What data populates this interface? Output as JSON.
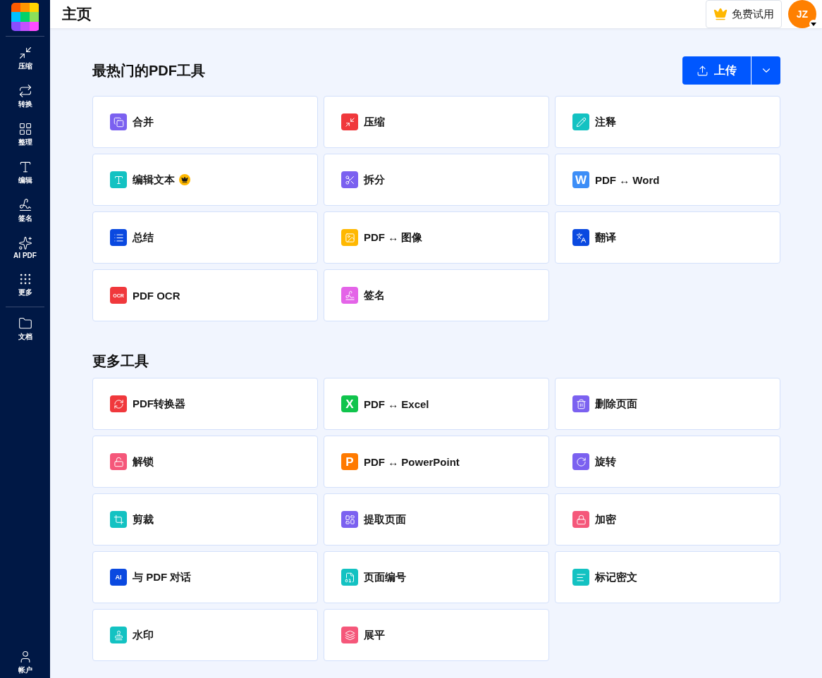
{
  "header": {
    "title": "主页",
    "trial_button": "免费试用",
    "avatar": "JZ"
  },
  "sidebar": {
    "items": [
      {
        "label": "压缩"
      },
      {
        "label": "转换"
      },
      {
        "label": "整理"
      },
      {
        "label": "编辑"
      },
      {
        "label": "签名"
      },
      {
        "label": "AI PDF"
      },
      {
        "label": "更多"
      }
    ],
    "documents": {
      "label": "文档"
    },
    "account": {
      "label": "帐户"
    }
  },
  "popular": {
    "title": "最热门的PDF工具",
    "upload_button": "上传",
    "tools": [
      {
        "label": "合并",
        "color": "#7b61f0"
      },
      {
        "label": "压缩",
        "color": "#f0383c"
      },
      {
        "label": "注释",
        "color": "#13c2c2"
      },
      {
        "label": "编辑文本",
        "color": "#13c2c2",
        "premium": true
      },
      {
        "label": "拆分",
        "color": "#7b61f0"
      },
      {
        "label": "PDF ↔ Word",
        "color": "#3d8ef7",
        "icon_text": "W"
      },
      {
        "label": "总结",
        "color": "#0a49e0"
      },
      {
        "label": "PDF ↔ 图像",
        "color": "#ffb800"
      },
      {
        "label": "翻译",
        "color": "#0a49e0"
      },
      {
        "label": "PDF OCR",
        "color": "#f0383c",
        "icon_text": "OCR"
      },
      {
        "label": "签名",
        "color": "#e464e8"
      }
    ]
  },
  "more": {
    "title": "更多工具",
    "tools": [
      {
        "label": "PDF转换器",
        "color": "#f0383c"
      },
      {
        "label": "PDF ↔ Excel",
        "color": "#10c44c",
        "icon_text": "X"
      },
      {
        "label": "删除页面",
        "color": "#7b61f0"
      },
      {
        "label": "解锁",
        "color": "#f5577a"
      },
      {
        "label": "PDF ↔ PowerPoint",
        "color": "#ff7a00",
        "icon_text": "P"
      },
      {
        "label": "旋转",
        "color": "#7b61f0"
      },
      {
        "label": "剪裁",
        "color": "#13c2c2"
      },
      {
        "label": "提取页面",
        "color": "#7b61f0"
      },
      {
        "label": "加密",
        "color": "#f5577a"
      },
      {
        "label": "与 PDF 对话",
        "color": "#0a49e0",
        "icon_text": "AI"
      },
      {
        "label": "页面编号",
        "color": "#13c2c2"
      },
      {
        "label": "标记密文",
        "color": "#13c2c2"
      },
      {
        "label": "水印",
        "color": "#13c2c2"
      },
      {
        "label": "展平",
        "color": "#f5577a"
      }
    ]
  }
}
